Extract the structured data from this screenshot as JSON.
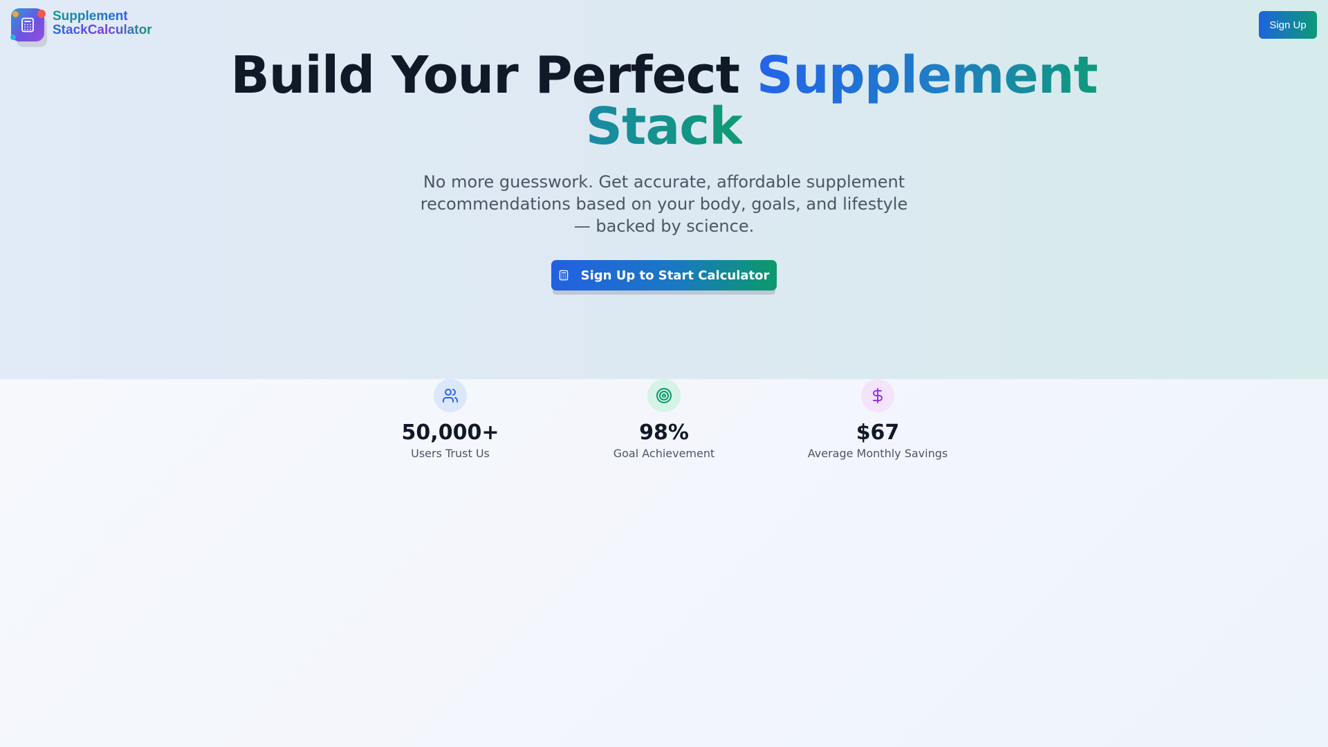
{
  "header": {
    "brand_line1": "Supplement",
    "brand_line2": "StackCalculator",
    "logo_icon": "calculator-icon",
    "signup_label": "Sign Up"
  },
  "hero": {
    "title_prefix": "Build Your Perfect ",
    "title_highlight": "Supplement",
    "title_line2": "Stack",
    "subtitle": "No more guesswork. Get accurate, affordable supplement recommendations based on your body, goals, and lifestyle — backed by science.",
    "cta_label": "Sign Up to Start Calculator",
    "cta_icon": "calculator-icon"
  },
  "stats": [
    {
      "icon": "users-icon",
      "value": "50,000+",
      "label": "Users Trust Us",
      "color": "#2563eb",
      "bg": "#dbe7fb"
    },
    {
      "icon": "target-icon",
      "value": "98%",
      "label": "Goal Achievement",
      "color": "#059669",
      "bg": "#d5f3e6"
    },
    {
      "icon": "dollar-icon",
      "value": "$67",
      "label": "Average Monthly Savings",
      "color": "#9333ea",
      "bg": "#f3e4fb"
    }
  ],
  "colors": {
    "primary_blue": "#2563eb",
    "primary_green": "#0f9a7a",
    "heading": "#111827",
    "body_text": "#4b5563"
  }
}
